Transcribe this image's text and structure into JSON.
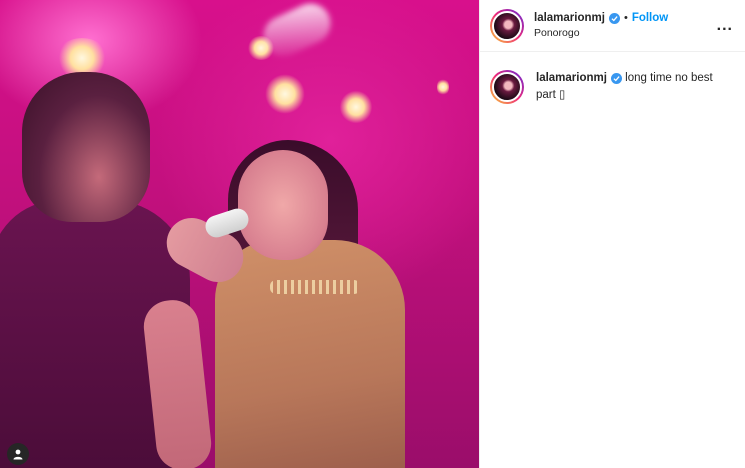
{
  "post": {
    "username": "lalamarionmj",
    "follow_label": "Follow",
    "separator": "•",
    "location": "Ponorogo",
    "more_label": "...",
    "caption_text": "long time no best part ▯"
  },
  "colors": {
    "follow_blue": "#0095f6",
    "verified_blue": "#3897f0",
    "stage_magenta": "#d8108c"
  },
  "icons": [
    "verified-badge-icon",
    "more-options-icon",
    "tagged-user-icon"
  ]
}
